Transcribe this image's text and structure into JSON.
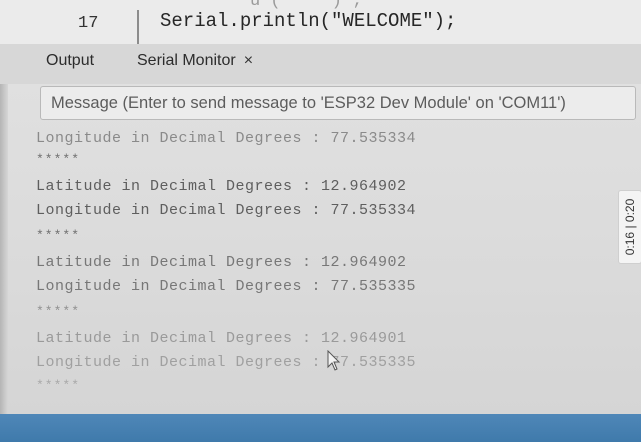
{
  "editor": {
    "previous_line_fragment": "u ( ' ' ) ;",
    "line_number": "17",
    "code_line": "Serial.println(\"WELCOME\");"
  },
  "tabs": {
    "output": "Output",
    "serial_monitor": "Serial Monitor",
    "close_symbol": "×"
  },
  "message_input": {
    "placeholder": "Message (Enter to send message to 'ESP32 Dev Module' on 'COM11')",
    "value": ""
  },
  "serial_output": {
    "lines": [
      "Longitude in Decimal Degrees : 77.535334",
      "*****",
      "Latitude in Decimal Degrees : 12.964902",
      "Longitude in Decimal Degrees : 77.535334",
      "*****",
      "Latitude in Decimal Degrees : 12.964902",
      "Longitude in Decimal Degrees : 77.535335",
      "*****",
      "Latitude in Decimal Degrees : 12.964901",
      "Longitude in Decimal Degrees : 77.535335",
      "*****"
    ]
  },
  "timestamp": "0:16 | 0:20",
  "colors": {
    "taskbar": "#4481b3",
    "output_text": "#6e6e6e"
  }
}
